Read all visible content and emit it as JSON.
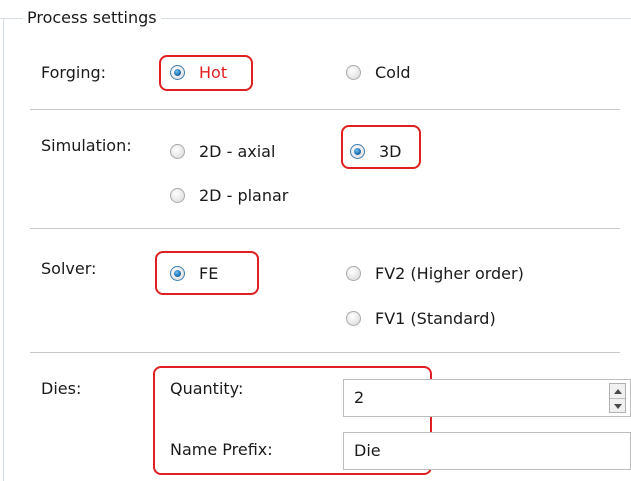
{
  "group": {
    "title": "Process settings"
  },
  "forging": {
    "label": "Forging:",
    "options": [
      {
        "label": "Hot",
        "selected": true
      },
      {
        "label": "Cold",
        "selected": false
      }
    ]
  },
  "simulation": {
    "label": "Simulation:",
    "options": [
      {
        "label": "2D - axial",
        "selected": false
      },
      {
        "label": "3D",
        "selected": true
      },
      {
        "label": "2D - planar",
        "selected": false
      }
    ]
  },
  "solver": {
    "label": "Solver:",
    "options": [
      {
        "label": "FE",
        "selected": true
      },
      {
        "label": "FV2 (Higher order)",
        "selected": false
      },
      {
        "label": "FV1 (Standard)",
        "selected": false
      }
    ]
  },
  "dies": {
    "label": "Dies:",
    "quantity_label": "Quantity:",
    "quantity_value": "2",
    "prefix_label": "Name Prefix:",
    "prefix_value": "Die"
  },
  "colors": {
    "highlight": "#e02020",
    "selected_text": "#e02020",
    "radio_selected": "#1d6fb0"
  },
  "icons": {
    "spinner": "up-down-spinner-icon"
  }
}
